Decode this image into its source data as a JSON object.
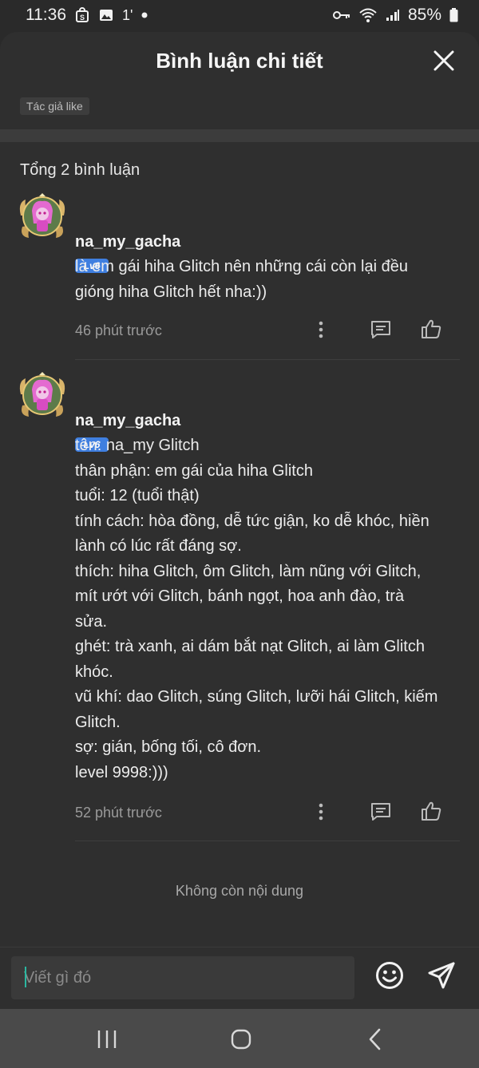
{
  "status": {
    "time": "11:36",
    "battery": "85%",
    "notif_extra": "1"
  },
  "header": {
    "title": "Bình luận chi tiết"
  },
  "filter_chip": "Tác giả like",
  "total_label": "Tổng 2 bình luận",
  "comments": [
    {
      "username": "na_my_gacha",
      "level": "Lv6",
      "lines": [
        "là em gái hiha Glitch nên những cái còn lại đều",
        "gióng hiha Glitch hết nha:))"
      ],
      "time": "46 phút trước"
    },
    {
      "username": "na_my_gacha",
      "level": "Lv6",
      "lines": [
        "tên: na_my Glitch",
        "thân phận: em gái của hiha Glitch",
        "tuổi: 12 (tuổi thật)",
        "tính cách: hòa đồng, dễ tức giận, ko dễ khóc, hiền",
        "lành có lúc rất đáng sợ.",
        "thích: hiha Glitch, ôm Glitch, làm nũng với Glitch,",
        "mít ướt với Glitch, bánh ngọt, hoa anh đào, trà",
        "sửa.",
        "ghét: trà xanh, ai dám bắt nạt Glitch, ai làm Glitch",
        "khóc.",
        "vũ khí: dao Glitch, súng Glitch, lưỡi hái Glitch, kiếm",
        "Glitch.",
        "sợ: gián, bống tối, cô đơn.",
        "level 9998:)))"
      ],
      "time": "52 phút trước"
    }
  ],
  "end_label": "Không còn nội dung",
  "input": {
    "placeholder": "Viết gì đó",
    "value": ""
  },
  "colors": {
    "background": "#2f2f2f",
    "level_badge": "#3f7fe0",
    "caret": "#2bb7a0"
  },
  "icons": [
    "close-icon",
    "more-icon",
    "reply-icon",
    "like-icon",
    "emoji-icon",
    "send-icon",
    "recents-icon",
    "home-icon",
    "back-icon"
  ]
}
